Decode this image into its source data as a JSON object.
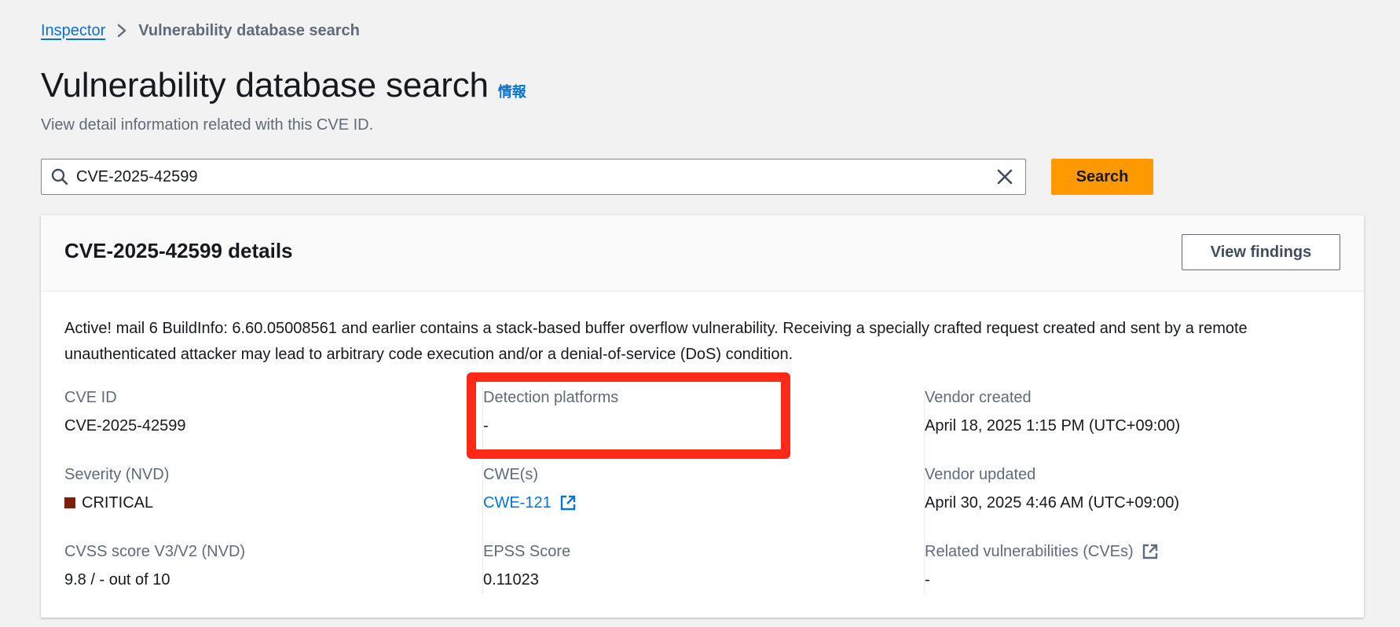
{
  "breadcrumb": {
    "parent": "Inspector",
    "current": "Vulnerability database search"
  },
  "page": {
    "title": "Vulnerability database search",
    "info_link": "情報",
    "subtitle": "View detail information related with this CVE ID."
  },
  "search": {
    "value": "CVE-2025-42599",
    "button_label": "Search"
  },
  "details": {
    "title": "CVE-2025-42599 details",
    "view_findings_label": "View findings",
    "description": "Active! mail 6 BuildInfo: 6.60.05008561 and earlier contains a stack-based buffer overflow vulnerability. Receiving a specially crafted request created and sent by a remote unauthenticated attacker may lead to arbitrary code execution and/or a denial-of-service (DoS) condition.",
    "fields": {
      "cve_id": {
        "label": "CVE ID",
        "value": "CVE-2025-42599"
      },
      "severity": {
        "label": "Severity (NVD)",
        "value": "CRITICAL",
        "color": "#7d2105"
      },
      "cvss": {
        "label": "CVSS score V3/V2 (NVD)",
        "value": "9.8 / - out of 10"
      },
      "detection_platforms": {
        "label": "Detection platforms",
        "value": "-"
      },
      "cwes": {
        "label": "CWE(s)",
        "value": "CWE-121"
      },
      "epss": {
        "label": "EPSS Score",
        "value": "0.11023"
      },
      "vendor_created": {
        "label": "Vendor created",
        "value": "April 18, 2025 1:15 PM (UTC+09:00)"
      },
      "vendor_updated": {
        "label": "Vendor updated",
        "value": "April 30, 2025 4:46 AM (UTC+09:00)"
      },
      "related": {
        "label": "Related vulnerabilities (CVEs)",
        "value": "-"
      }
    }
  },
  "colors": {
    "link": "#0972d3",
    "primary_button": "#ff9900",
    "highlight": "#fe2a17"
  },
  "icons": {
    "breadcrumb_separator": "chevron-right-icon",
    "search": "search-icon",
    "clear": "close-icon",
    "external_link": "external-link-icon"
  }
}
